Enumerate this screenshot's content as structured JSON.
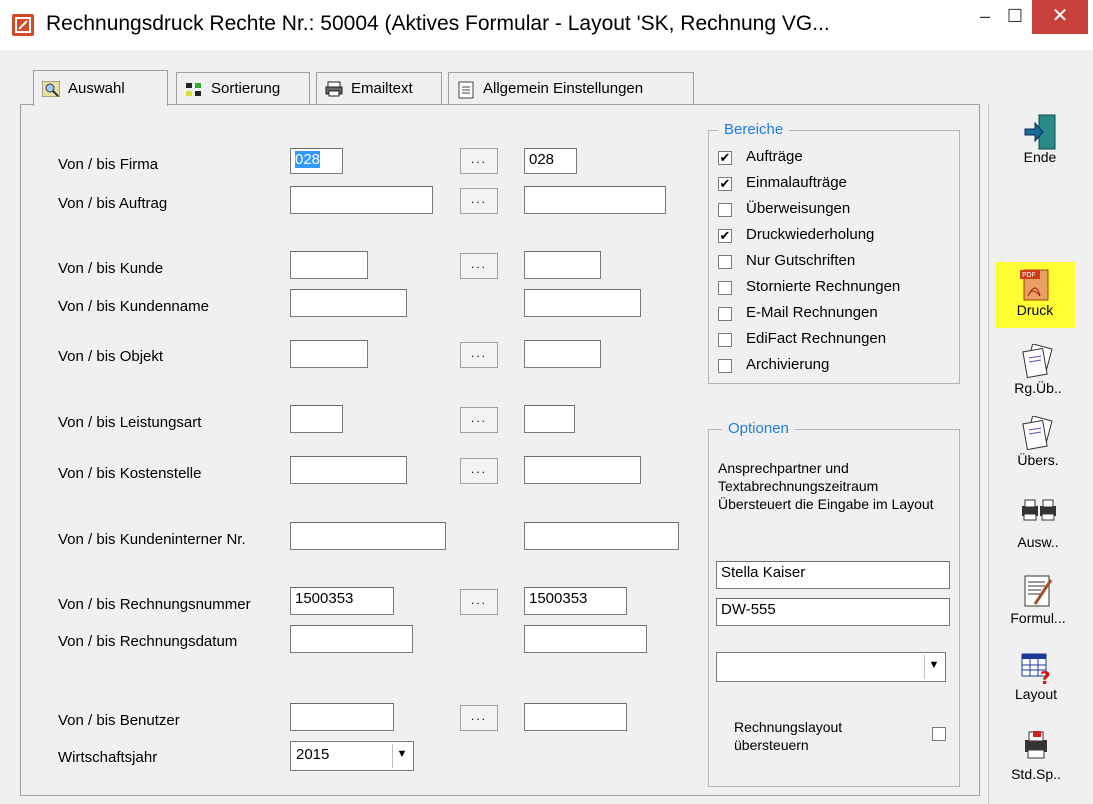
{
  "window": {
    "title": "Rechnungsdruck Rechte Nr.: 50004   (Aktives Formular - Layout 'SK, Rechnung VG...",
    "min_glyph": "–",
    "max_glyph": "☐",
    "close_glyph": "✕"
  },
  "tabs": [
    {
      "label": "Auswahl",
      "icon": "search-icon"
    },
    {
      "label": "Sortierung",
      "icon": "sort-icon"
    },
    {
      "label": "Emailtext",
      "icon": "printer-icon"
    },
    {
      "label": "Allgemein Einstellungen",
      "icon": "document-icon"
    }
  ],
  "form": {
    "dots_label": "...",
    "rows": [
      {
        "label": "Von / bis Firma",
        "from": "028",
        "to": "028"
      },
      {
        "label": "Von / bis Auftrag",
        "from": "",
        "to": ""
      },
      {
        "label": "Von / bis Kunde",
        "from": "",
        "to": ""
      },
      {
        "label": "Von / bis Kundenname",
        "from": "",
        "to": ""
      },
      {
        "label": "Von / bis Objekt",
        "from": "",
        "to": ""
      },
      {
        "label": "Von / bis Leistungsart",
        "from": "",
        "to": ""
      },
      {
        "label": "Von / bis Kostenstelle",
        "from": "",
        "to": ""
      },
      {
        "label": "Von / bis Kundeninterner Nr.",
        "from": "",
        "to": ""
      },
      {
        "label": "Von / bis Rechnungsnummer",
        "from": "1500353",
        "to": "1500353"
      },
      {
        "label": "Von / bis Rechnungsdatum",
        "from": "",
        "to": ""
      },
      {
        "label": "Von / bis Benutzer",
        "from": "",
        "to": ""
      }
    ],
    "wirtschaftsjahr_label": "Wirtschaftsjahr",
    "wirtschaftsjahr_value": "2015"
  },
  "bereiche": {
    "title": "Bereiche",
    "items": [
      {
        "label": "Aufträge",
        "checked": true
      },
      {
        "label": "Einmalaufträge",
        "checked": true
      },
      {
        "label": "Überweisungen",
        "checked": false
      },
      {
        "label": "Druckwiederholung",
        "checked": true
      },
      {
        "label": "Nur Gutschriften",
        "checked": false
      },
      {
        "label": "Stornierte Rechnungen",
        "checked": false
      },
      {
        "label": "E-Mail Rechnungen",
        "checked": false
      },
      {
        "label": "EdiFact Rechnungen",
        "checked": false
      },
      {
        "label": "Archivierung",
        "checked": false
      }
    ]
  },
  "optionen": {
    "title": "Optionen",
    "description": "Ansprechpartner und Textabrechnungszeitraum Übersteuert die Eingabe im Layout",
    "contact": "Stella Kaiser",
    "code": "DW-555",
    "combo_value": "",
    "layout_override_label": "Rechnungslayout übersteuern",
    "layout_override_checked": false
  },
  "toolbar": [
    {
      "label": "Ende",
      "icon": "exit-door-icon",
      "highlight": false
    },
    {
      "label": "Druck",
      "icon": "pdf-icon",
      "highlight": true,
      "highlight_color": "#ffff33"
    },
    {
      "label": "Rg.Üb..",
      "icon": "invoice-overview-icon",
      "highlight": false
    },
    {
      "label": "Übers.",
      "icon": "overview-icon",
      "highlight": false
    },
    {
      "label": "Ausw..",
      "icon": "printers-icon",
      "highlight": false
    },
    {
      "label": "Formul...",
      "icon": "form-edit-icon",
      "highlight": false
    },
    {
      "label": "Layout",
      "icon": "layout-help-icon",
      "highlight": false
    },
    {
      "label": "Std.Sp..",
      "icon": "save-printer-icon",
      "highlight": false
    }
  ],
  "colors": {
    "accent_title": "#1e7de0",
    "close_button": "#c7403a",
    "selection": "#3399ff"
  }
}
